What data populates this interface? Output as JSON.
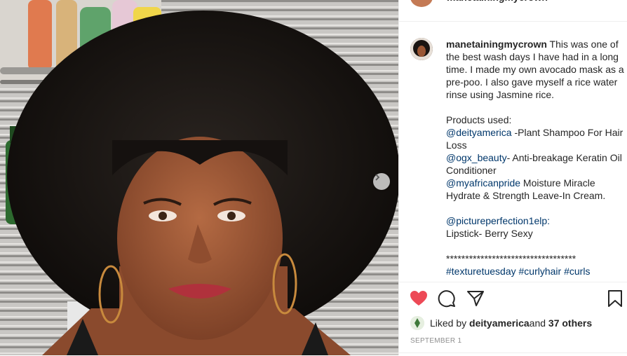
{
  "post": {
    "username": "manetainingmycrown",
    "caption_intro": " This was one of the best wash days I have had in a long time. I made my own avocado mask as a pre-poo. I also gave myself a rice water rinse using Jasmine rice.",
    "products_heading": "Products used:",
    "product_1_mention": "@deityamerica",
    "product_1_text": " -Plant Shampoo For Hair Loss",
    "product_2_mention": "@ogx_beauty",
    "product_2_text": "- Anti-breakage Keratin Oil Conditioner",
    "product_3_mention": "@myafricanpride",
    "product_3_text": " Moisture Miracle Hydrate & Strength Leave-In Cream.",
    "lipstick_mention": "@pictureperfection1elp:",
    "lipstick_text": "Lipstick- Berry Sexy",
    "divider": "**********************************",
    "hashtags": [
      "#texturetuesday",
      "#curlyhair",
      "#curls"
    ]
  },
  "likes": {
    "prefix": "Liked by ",
    "liker": "deityamerica",
    "middle": " and ",
    "others": "37 others"
  },
  "date": "SEPTEMBER 1",
  "colors": {
    "heart": "#ed4956",
    "link": "#00376b",
    "muted": "#8e8e8e"
  },
  "icons": [
    "heart-icon",
    "comment-icon",
    "share-icon",
    "bookmark-icon",
    "chevron-right-icon"
  ]
}
